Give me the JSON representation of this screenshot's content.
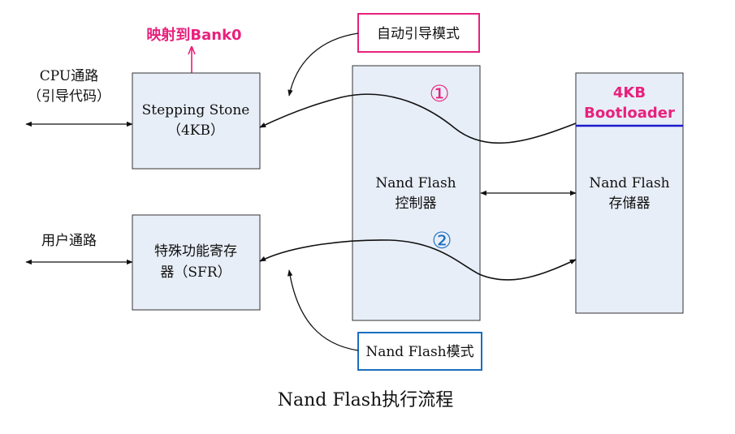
{
  "caption": "Nand Flash执行流程",
  "cpu_path": {
    "line1": "CPU通路",
    "line2": "（引导代码）"
  },
  "user_path": {
    "label": "用户通路"
  },
  "stepping_stone": {
    "line1": "Stepping Stone",
    "line2": "（4KB）"
  },
  "mapped_label": "映射到Bank0",
  "auto_boot_mode": "自动引导模式",
  "sfr": {
    "line1": "特殊功能寄存",
    "line2": "器（SFR）"
  },
  "nand_mode": "Nand Flash模式",
  "controller": {
    "line1": "Nand Flash",
    "line2": "控制器"
  },
  "storage": {
    "line1": "Nand Flash",
    "line2": "存储器"
  },
  "bootloader": {
    "line1": "4KB",
    "line2": "Bootloader"
  },
  "step_markers": {
    "one": "①",
    "two": "②"
  },
  "colors": {
    "box_fill": "#e8eef8",
    "highlight_pink": "#e8217c",
    "highlight_blue": "#1a6fbf",
    "bootloader_line": "#1a1acc"
  }
}
